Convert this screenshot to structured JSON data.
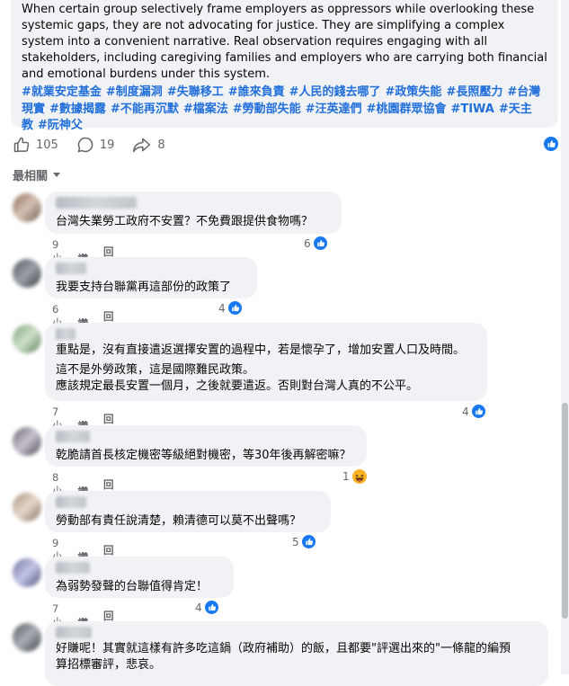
{
  "post": {
    "text": "When certain group selectively frame employers as oppressors while overlooking these systemic gaps, they are not advocating for justice. They are simplifying a complex system into a convenient narrative. Real observation requires engaging with all stakeholders, including caregiving families and employers who are carrying both financial and emotional burdens under this system.",
    "hashtags": [
      "#就業安定基金",
      "#制度漏洞",
      "#失聯移工",
      "#誰來負責",
      "#人民的錢去哪了",
      "#政策失能",
      "#長照壓力",
      "#台灣現實",
      "#數據揭露",
      "#不能再沉默",
      "#檔案法",
      "#勞動部失能",
      "#汪英達們",
      "#桃園群眾協會",
      "#TIWA",
      "#天主教",
      "#阮神父"
    ]
  },
  "actions": {
    "likes": "105",
    "comments": "19",
    "shares": "8"
  },
  "sort_label": "最相關",
  "comments": [
    {
      "text": [
        "台灣失業勞工政府不安置？不免費跟提供食物嗎？"
      ],
      "time": "9小時",
      "like_label": "讚",
      "reply_label": "回覆",
      "reactions": "6",
      "reaction_icon": "like-icon"
    },
    {
      "text": [
        "我要支持台聯黨再這部份的政策了"
      ],
      "time": "6小時",
      "like_label": "讚",
      "reply_label": "回覆",
      "reactions": "4",
      "reaction_icon": "like-icon"
    },
    {
      "text": [
        "重點是，沒有直接遣返選擇安置的過程中，若是懷孕了，增加安置人口及時間。",
        "這不是外勞政策，這是國際難民政策。",
        "應該規定最長安置一個月，之後就要遣返。否則對台灣人真的不公平。"
      ],
      "time": "7小時",
      "like_label": "讚",
      "reply_label": "回覆",
      "reactions": "4",
      "reaction_icon": "like-icon"
    },
    {
      "text": [
        "乾脆請首長核定機密等級絕對機密，等30年後再解密嘛？"
      ],
      "time": "8小時",
      "like_label": "讚",
      "reply_label": "回覆",
      "reactions": "1",
      "reaction_icon": "haha-icon"
    },
    {
      "text": [
        "勞動部有責任說清楚，賴清德可以莫不出聲嗎？"
      ],
      "time": "9小時",
      "like_label": "讚",
      "reply_label": "回覆",
      "reactions": "5",
      "reaction_icon": "like-icon"
    },
    {
      "text": [
        "為弱勢發聲的台聯值得肯定！"
      ],
      "time": "7小時",
      "like_label": "讚",
      "reply_label": "回覆",
      "reactions": "4",
      "reaction_icon": "like-icon"
    },
    {
      "text": [
        "好賺呢！其實就這樣有許多吃這鍋（政府補助）的飯，且都要\"評選出來的\"一條龍的編預",
        "算招標審評，悲哀。"
      ]
    }
  ],
  "colors": {
    "accent": "#216fdb",
    "like_blue": "#1877f2",
    "bubble": "#f0f2f5",
    "muted": "#65676b"
  }
}
